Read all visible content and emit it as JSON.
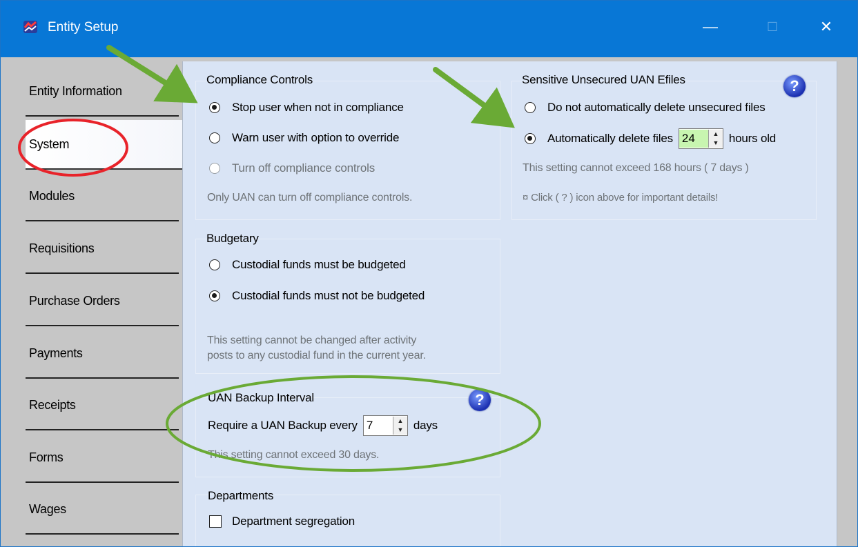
{
  "window": {
    "title": "Entity Setup",
    "min_icon": "—",
    "max_icon": "☐",
    "close_icon": "✕"
  },
  "tabs": [
    {
      "label": "Entity Information"
    },
    {
      "label": "System"
    },
    {
      "label": "Modules"
    },
    {
      "label": "Requisitions"
    },
    {
      "label": "Purchase Orders"
    },
    {
      "label": "Payments"
    },
    {
      "label": "Receipts"
    },
    {
      "label": "Forms"
    },
    {
      "label": "Wages"
    }
  ],
  "compliance": {
    "title": "Compliance Controls",
    "options": [
      {
        "label": "Stop user when not in compliance",
        "checked": true
      },
      {
        "label": "Warn user with option to override",
        "checked": false
      },
      {
        "label": "Turn off compliance controls",
        "checked": false,
        "disabled": true
      }
    ],
    "note": "Only UAN can turn off compliance controls."
  },
  "sensitive": {
    "title": "Sensitive Unsecured UAN Efiles",
    "help": "?",
    "option1": "Do not automatically delete unsecured files",
    "option2_prefix": "Automatically delete files",
    "hours_value": "24",
    "option2_suffix": "hours old",
    "note1": "This setting cannot exceed 168 hours ( 7 days )",
    "note2": "¤ Click ( ? ) icon above for important details!"
  },
  "budgetary": {
    "title": "Budgetary",
    "option1": "Custodial funds must be budgeted",
    "option2": "Custodial funds must not be budgeted",
    "note_line1": "This setting cannot be changed after activity",
    "note_line2": "posts to any custodial fund in the current year."
  },
  "backup": {
    "title": "UAN Backup Interval",
    "help": "?",
    "prefix": "Require a UAN Backup every",
    "days_value": "7",
    "suffix": "days",
    "note": "This setting cannot exceed 30 days."
  },
  "departments": {
    "title": "Departments",
    "option": "Department segregation"
  },
  "colors": {
    "titlebar": "#0877d6",
    "panel": "#d9e4f5",
    "annotation_green": "#6aaa35",
    "annotation_red": "#e8232a"
  }
}
